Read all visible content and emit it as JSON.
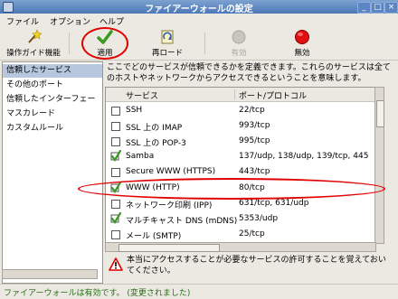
{
  "window": {
    "title": "ファイアーウォールの設定"
  },
  "menubar": {
    "items": [
      "ファイル",
      "オプション",
      "ヘルプ"
    ]
  },
  "toolbar": {
    "wizard_label": "操作ガイド機能",
    "apply_label": "適用",
    "reload_label": "再ロード",
    "enable_label": "有効",
    "disable_label": "無効"
  },
  "sidebar": {
    "items": [
      {
        "label": "信頼したサービス",
        "selected": true
      },
      {
        "label": "その他のポート",
        "selected": false
      },
      {
        "label": "信頼したインターフェー",
        "selected": false
      },
      {
        "label": "マスカレード",
        "selected": false
      },
      {
        "label": "カスタムルール",
        "selected": false
      }
    ]
  },
  "main": {
    "description": "ここでどのサービスが信頼できるかを定義できます。これらのサービスは全てのホストやネットワークからアクセスできるということを意味します。",
    "table": {
      "col_service": "サービス",
      "col_port": "ポート/プロトコル",
      "rows": [
        {
          "service": "SSH",
          "port": "22/tcp",
          "checked": false
        },
        {
          "service": "SSL 上の IMAP",
          "port": "993/tcp",
          "checked": false
        },
        {
          "service": "SSL 上の POP-3",
          "port": "995/tcp",
          "checked": false
        },
        {
          "service": "Samba",
          "port": "137/udp, 138/udp, 139/tcp, 445",
          "checked": true
        },
        {
          "service": "Secure WWW (HTTPS)",
          "port": "443/tcp",
          "checked": false
        },
        {
          "service": "WWW (HTTP)",
          "port": "80/tcp",
          "checked": true
        },
        {
          "service": "ネットワーク印刷 (IPP)",
          "port": "631/tcp, 631/udp",
          "checked": false
        },
        {
          "service": "マルチキャスト DNS (mDNS)",
          "port": "5353/udp",
          "checked": true
        },
        {
          "service": "メール (SMTP)",
          "port": "25/tcp",
          "checked": false
        }
      ]
    },
    "warning": "本当にアクセスすることが必要なサービスの許可することを覚えておいてください。"
  },
  "status": {
    "text": "ファイアーウォールは有効です。 (変更されました)"
  },
  "colors": {
    "highlight": "#e00000",
    "status_text": "#2a6e1a",
    "check": "#3a9a1f"
  }
}
